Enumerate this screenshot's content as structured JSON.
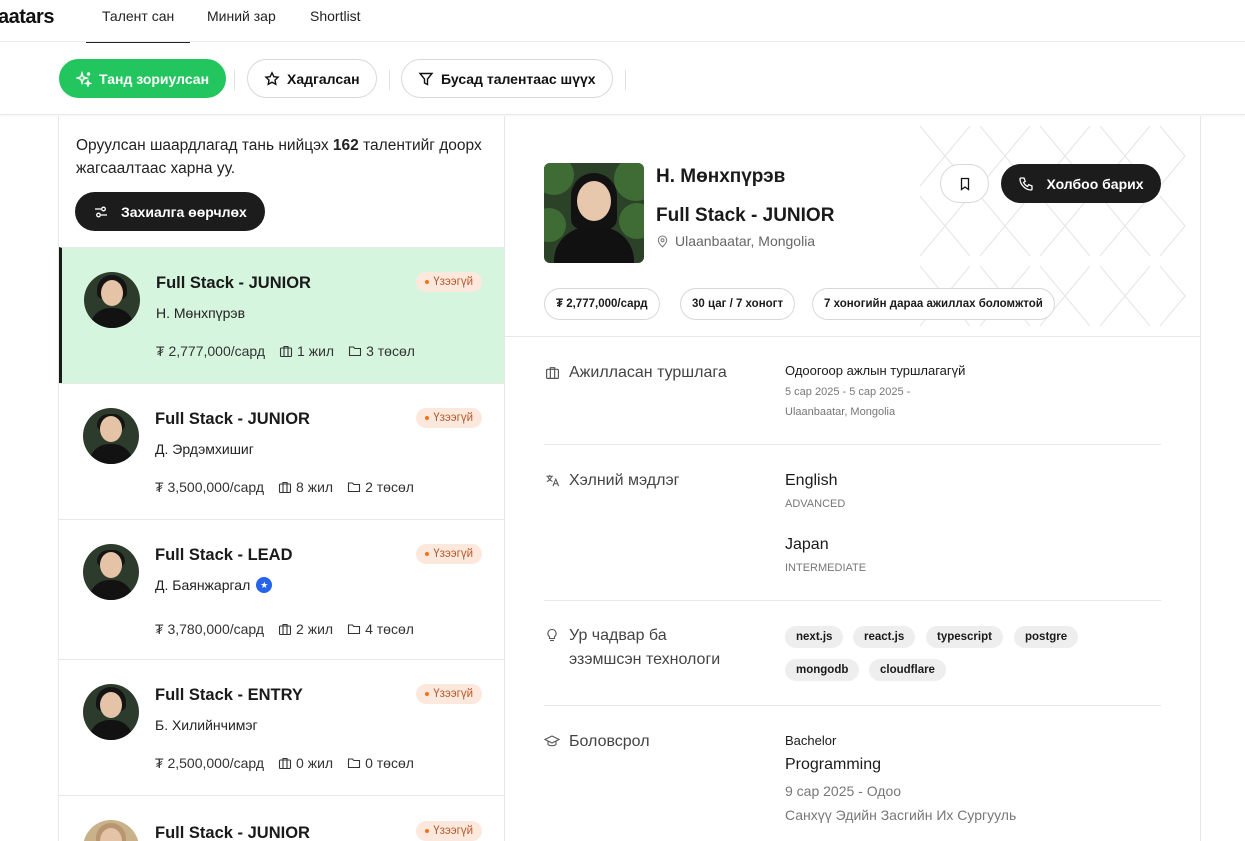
{
  "app": {
    "logo": "aatars"
  },
  "nav": {
    "tabs": [
      {
        "label": "Талент сан",
        "active": true
      },
      {
        "label": "Миний зар",
        "active": false
      },
      {
        "label": "Shortlist",
        "active": false
      }
    ]
  },
  "filters": {
    "recommended": "Танд зориулсан",
    "saved": "Хадгалсан",
    "filter_other": "Бусад талентаас шүүх"
  },
  "list": {
    "intro_pre": "Оруулсан шаардлагад тань нийцэх",
    "intro_count": "162",
    "intro_post": "талентийг доорх жагсаалтаас харна уу.",
    "edit_order_button": "Захиалга өөрчлөх",
    "items": [
      {
        "title": "Full Stack - JUNIOR",
        "name": "Н. Мөнхпүрэв",
        "salary": "₮ 2,777,000/сард",
        "experience": "1 жил",
        "projects": "3 төсөл",
        "status": "Үзээгүй",
        "selected": true
      },
      {
        "title": "Full Stack - JUNIOR",
        "name": "Д. Эрдэмхишиг",
        "salary": "₮ 3,500,000/сард",
        "experience": "8 жил",
        "projects": "2 төсөл",
        "status": "Үзээгүй",
        "selected": false
      },
      {
        "title": "Full Stack - LEAD",
        "name": "Д. Баянжаргал",
        "salary": "₮ 3,780,000/сард",
        "experience": "2 жил",
        "projects": "4 төсөл",
        "status": "Үзээгүй",
        "verified": true,
        "selected": false
      },
      {
        "title": "Full Stack - ENTRY",
        "name": "Б. Хилийнчимэг",
        "salary": "₮ 2,500,000/сард",
        "experience": "0 жил",
        "projects": "0 төсөл",
        "status": "Үзээгүй",
        "selected": false
      },
      {
        "title": "Full Stack - JUNIOR",
        "status": "Үзээгүй",
        "selected": false
      }
    ]
  },
  "detail": {
    "name": "Н. Мөнхпүрэв",
    "title": "Full Stack - JUNIOR",
    "location": "Ulaanbaatar, Mongolia",
    "contact_button": "Холбоо барих",
    "chips": [
      "₮ 2,777,000/сард",
      "30 цаг / 7 хоногт",
      "7 хоногийн дараа ажиллах боломжтой"
    ],
    "experience": {
      "label": "Ажилласан туршлага",
      "value": "Одоогоор ажлын туршлагагүй",
      "dates": "5 сар 2025 - 5 сар 2025 -",
      "place": "Ulaanbaatar, Mongolia"
    },
    "languages": {
      "label": "Хэлний мэдлэг",
      "items": [
        {
          "name": "English",
          "level": "ADVANCED"
        },
        {
          "name": "Japan",
          "level": "INTERMEDIATE"
        }
      ]
    },
    "skills": {
      "label_line1": "Ур чадвар ба",
      "label_line2": "эзэмшсэн технологи",
      "items": [
        "next.js",
        "react.js",
        "typescript",
        "postgre",
        "mongodb",
        "cloudflare"
      ]
    },
    "education": {
      "label": "Боловсрол",
      "degree": "Bachelor",
      "field": "Programming",
      "dates": "9 сар 2025 - Одоо",
      "school": "Санхүү Эдийн Засгийн Их Сургууль"
    }
  }
}
